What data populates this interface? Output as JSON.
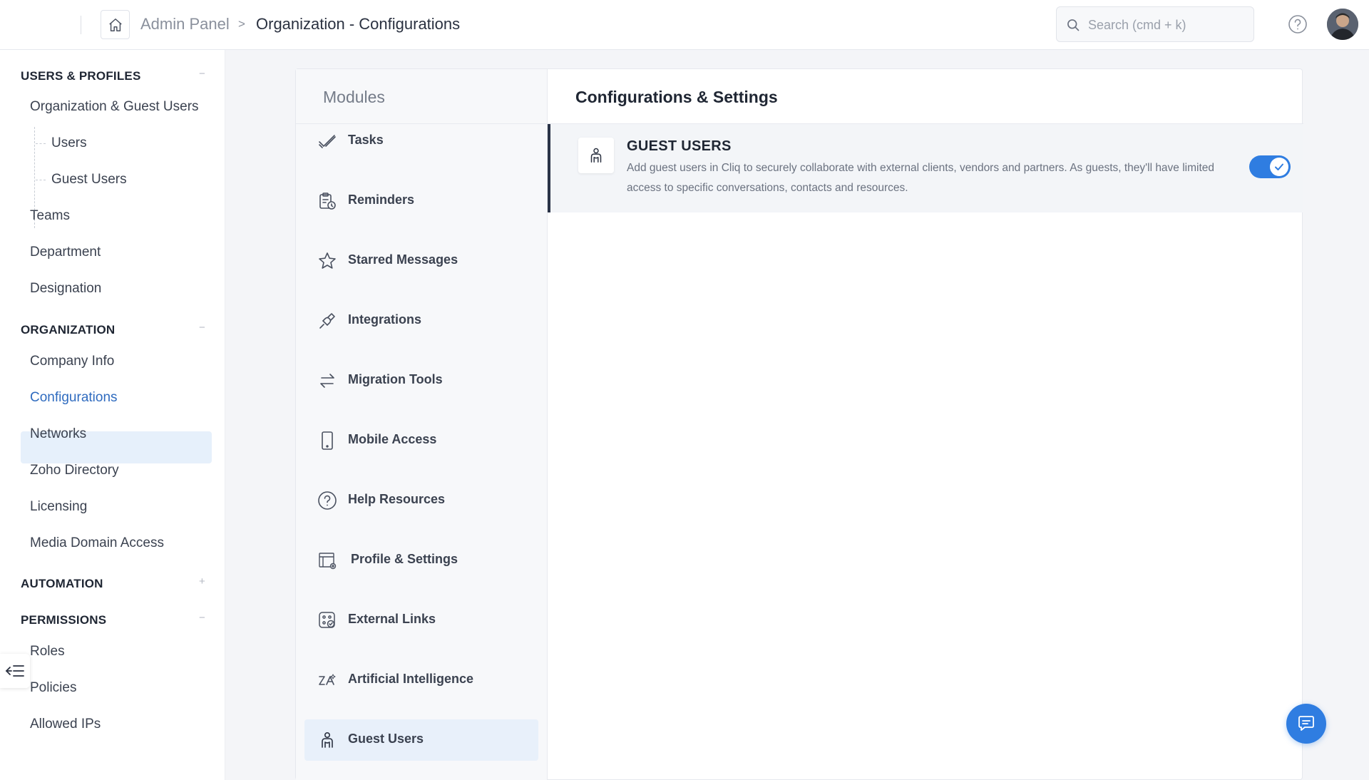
{
  "header": {
    "breadcrumb_root": "Admin Panel",
    "breadcrumb_separator": ">",
    "breadcrumb_current": "Organization - Configurations",
    "search_placeholder": "Search (cmd + k)"
  },
  "sidebar": {
    "sections": [
      {
        "title": "USERS & PROFILES",
        "toggle": "−"
      },
      {
        "title": "ORGANIZATION",
        "toggle": "−"
      },
      {
        "title": "AUTOMATION",
        "toggle": "+"
      },
      {
        "title": "PERMISSIONS",
        "toggle": "−"
      }
    ],
    "items": [
      "Organization & Guest Users",
      "Users",
      "Guest Users",
      "Teams",
      "Department",
      "Designation",
      "Company Info",
      "Configurations",
      "Networks",
      "Zoho Directory",
      "Licensing",
      "Media Domain Access",
      "Roles",
      "Policies",
      "Allowed IPs"
    ],
    "active_item": "Configurations"
  },
  "modules": {
    "title": "Modules",
    "items": [
      {
        "label": "Tasks",
        "icon": "tasks-icon"
      },
      {
        "label": "Reminders",
        "icon": "reminders-icon"
      },
      {
        "label": "Starred Messages",
        "icon": "star-icon"
      },
      {
        "label": "Integrations",
        "icon": "plug-icon"
      },
      {
        "label": "Migration Tools",
        "icon": "migration-icon"
      },
      {
        "label": "Mobile Access",
        "icon": "mobile-icon"
      },
      {
        "label": "Help Resources",
        "icon": "help-icon"
      },
      {
        "label": "Profile & Settings",
        "icon": "profile-settings-icon"
      },
      {
        "label": "External Links",
        "icon": "external-links-icon"
      },
      {
        "label": "Artificial Intelligence",
        "icon": "ai-icon"
      },
      {
        "label": "Guest Users",
        "icon": "guest-user-icon"
      }
    ],
    "active": "Guest Users"
  },
  "settings": {
    "title": "Configurations & Settings",
    "item": {
      "name": "GUEST USERS",
      "description": "Add guest users in Cliq to securely collaborate with external clients, vendors and partners. As guests, they'll have limited access to specific conversations, contacts and resources.",
      "enabled": true
    }
  },
  "colors": {
    "accent": "#2f7de1",
    "active_nav_bg": "#e6f0fb",
    "active_nav_text": "#2f6bbf"
  }
}
